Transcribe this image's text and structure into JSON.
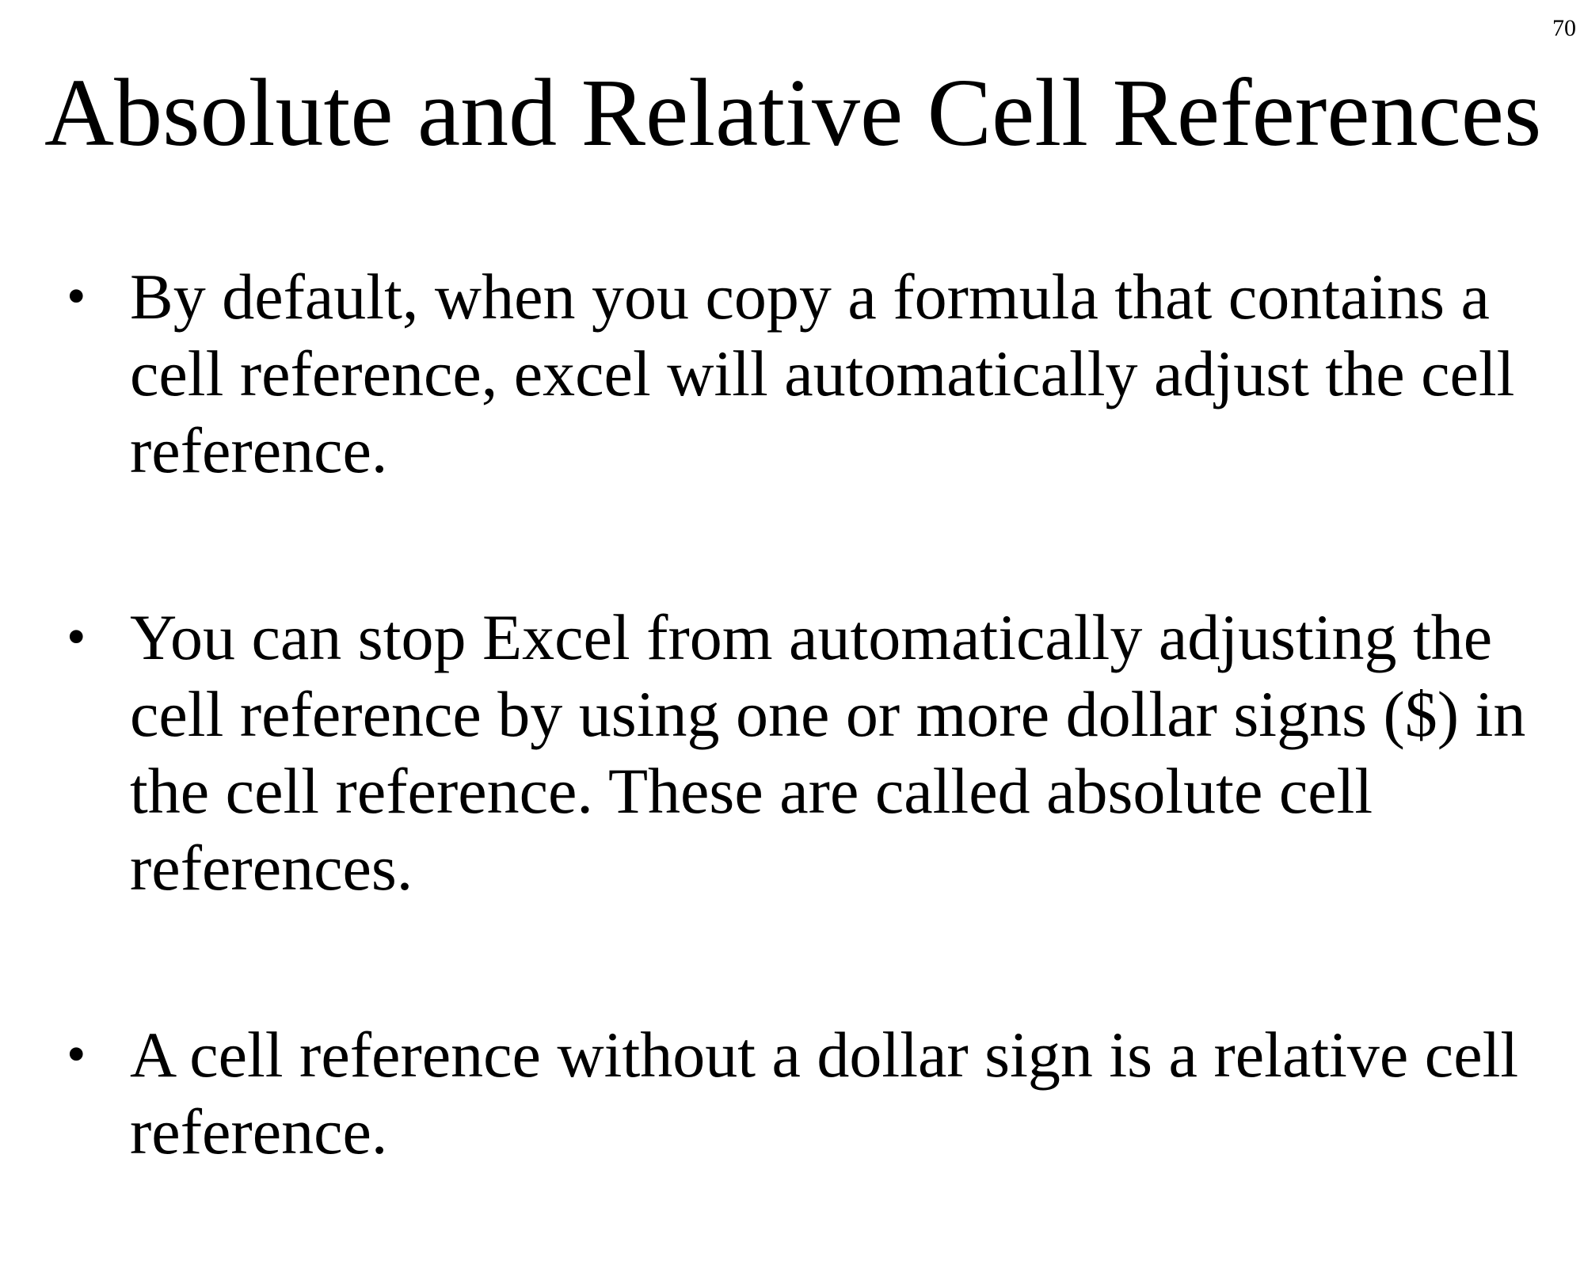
{
  "page_number": "70",
  "title": "Absolute and Relative Cell References",
  "bullet_marker": "•",
  "bullets": [
    {
      "text": "By default, when you copy a formula that contains a cell reference, excel will automatically adjust the cell reference."
    },
    {
      "text": "You can stop Excel from automatically adjusting the cell reference by using one or more dollar signs ($) in the cell reference. These are called absolute cell references."
    },
    {
      "text": "A cell reference without a dollar sign is a relative cell reference."
    }
  ]
}
